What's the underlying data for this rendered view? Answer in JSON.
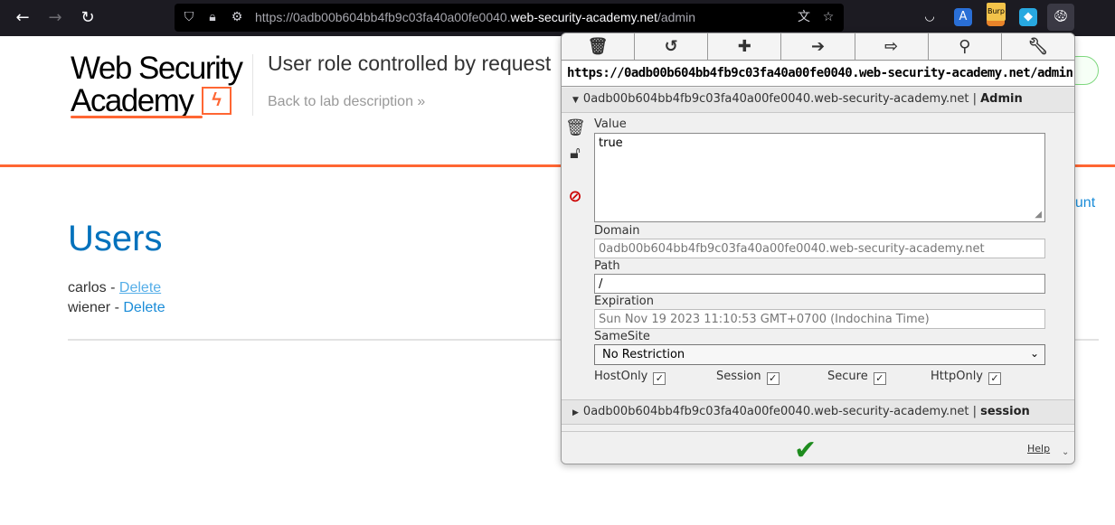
{
  "browser": {
    "url_prefix": "https://0adb00b604bb4fb9c03fa40a00fe0040.",
    "url_host": "web-security-academy.net",
    "url_path": "/admin",
    "ext_burp_label": "Burp"
  },
  "page": {
    "logo_line1": "Web Security",
    "logo_line2": "Academy",
    "lab_title": "User role controlled by request",
    "back_link": "Back to lab description »",
    "account_link": "ount",
    "users_heading": "Users",
    "users": [
      {
        "name": "carlos - ",
        "action": "Delete"
      },
      {
        "name": "wiener - ",
        "action": "Delete"
      }
    ]
  },
  "cookie_editor": {
    "toolbar": [
      "delete-all",
      "reset",
      "add",
      "import",
      "export",
      "search",
      "options"
    ],
    "url": "https://0adb00b604bb4fb9c03fa40a00fe0040.web-security-academy.net/admin",
    "cookies": [
      {
        "domain": "0adb00b604bb4fb9c03fa40a00fe0040.web-security-academy.net",
        "name": "Admin",
        "expanded": true
      },
      {
        "domain": "0adb00b604bb4fb9c03fa40a00fe0040.web-security-academy.net",
        "name": "session",
        "expanded": false
      }
    ],
    "separator": " | ",
    "labels": {
      "value": "Value",
      "domain": "Domain",
      "path": "Path",
      "expiration": "Expiration",
      "samesite": "SameSite",
      "hostonly": "HostOnly",
      "session": "Session",
      "secure": "Secure",
      "httponly": "HttpOnly",
      "help": "Help"
    },
    "fields": {
      "value": "true",
      "domain": "0adb00b604bb4fb9c03fa40a00fe0040.web-security-academy.net",
      "path": "/",
      "expiration": "Sun Nov 19 2023 11:10:53 GMT+0700 (Indochina Time)",
      "samesite": "No Restriction"
    },
    "flags": {
      "hostonly": true,
      "session": true,
      "secure": true,
      "httponly": true
    }
  }
}
